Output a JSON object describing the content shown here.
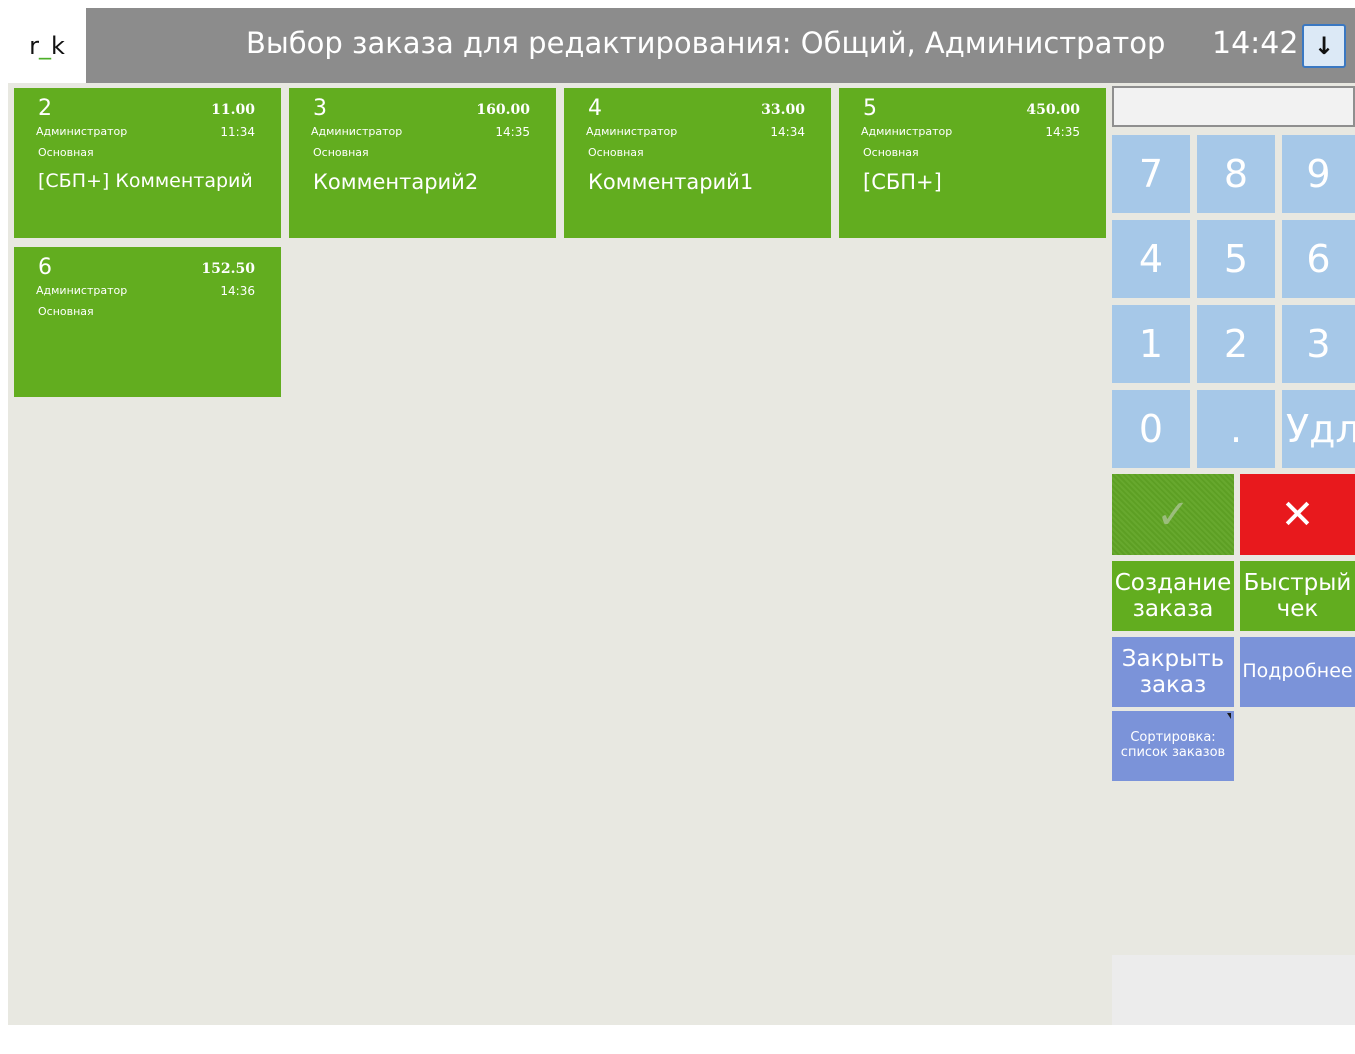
{
  "app": {
    "logo_text": "r_k",
    "header_title": "Выбор заказа для редактирования: Общий, Администратор",
    "time": "14:42",
    "down_button_icon": "arrow-down-icon"
  },
  "orders": [
    {
      "number": "2",
      "amount": "11.00",
      "user": "Администратор",
      "time": "11:34",
      "hall": "Основная",
      "comment": "[СБП+] Комментарий"
    },
    {
      "number": "3",
      "amount": "160.00",
      "user": "Администратор",
      "time": "14:35",
      "hall": "Основная",
      "comment": "Комментарий2"
    },
    {
      "number": "4",
      "amount": "33.00",
      "user": "Администратор",
      "time": "14:34",
      "hall": "Основная",
      "comment": "Комментарий1"
    },
    {
      "number": "5",
      "amount": "450.00",
      "user": "Администратор",
      "time": "14:35",
      "hall": "Основная",
      "comment": "[СБП+]"
    },
    {
      "number": "6",
      "amount": "152.50",
      "user": "Администратор",
      "time": "14:36",
      "hall": "Основная",
      "comment": ""
    }
  ],
  "numpad": {
    "display_value": "",
    "keys": [
      "7",
      "8",
      "9",
      "4",
      "5",
      "6",
      "1",
      "2",
      "3",
      "0",
      ".",
      "Удл"
    ],
    "ok_icon": "checkmark-icon",
    "cancel_icon": "close-icon",
    "cancel_symbol": "✕",
    "ok_symbol": "✓"
  },
  "actions": {
    "create_order_line1": "Создание",
    "create_order_line2": "заказа",
    "quick_check_line1": "Быстрый",
    "quick_check_line2": "чек",
    "close_order_line1": "Закрыть",
    "close_order_line2": "заказ",
    "details": "Подробнее",
    "sort_line1": "Сортировка:",
    "sort_line2": "список заказов"
  },
  "colors": {
    "tile_green": "#62ad1f",
    "key_blue": "#a6c8e8",
    "action_blue": "#7b93d9",
    "cancel_red": "#e8191d",
    "header_gray": "#8c8c8c"
  }
}
